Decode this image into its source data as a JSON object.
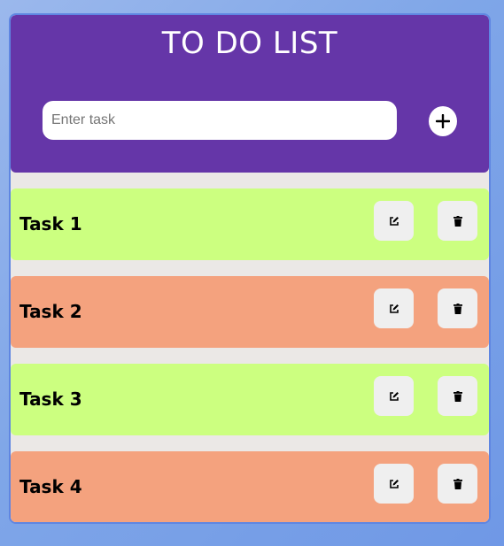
{
  "header": {
    "title": "TO DO LIST",
    "input_placeholder": "Enter task",
    "input_value": "",
    "add_icon": "plus-icon"
  },
  "colors": {
    "header_bg": "#6536a8",
    "task_green": "#ccff80",
    "task_orange": "#f4a27e",
    "panel_bg": "#ebe8e6"
  },
  "tasks": [
    {
      "label": "Task 1",
      "color": "#ccff80",
      "edit_icon": "edit-icon",
      "delete_icon": "trash-icon"
    },
    {
      "label": "Task 2",
      "color": "#f4a27e",
      "edit_icon": "edit-icon",
      "delete_icon": "trash-icon"
    },
    {
      "label": "Task 3",
      "color": "#ccff80",
      "edit_icon": "edit-icon",
      "delete_icon": "trash-icon"
    },
    {
      "label": "Task 4",
      "color": "#f4a27e",
      "edit_icon": "edit-icon",
      "delete_icon": "trash-icon"
    }
  ]
}
